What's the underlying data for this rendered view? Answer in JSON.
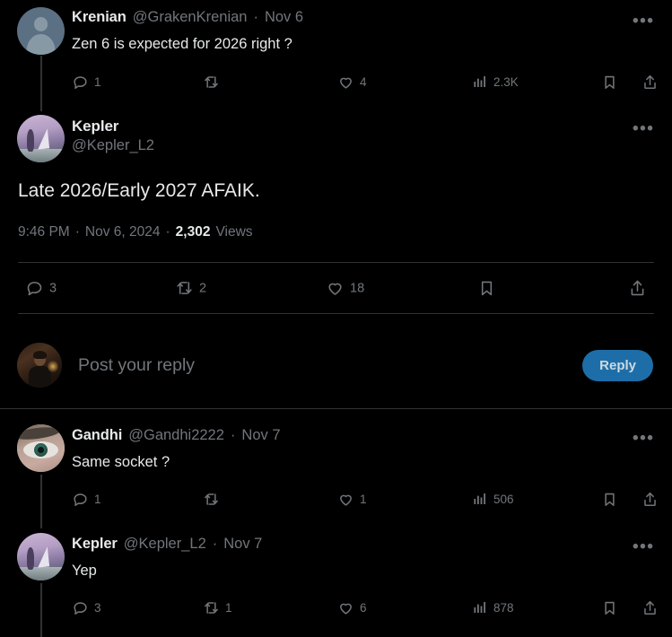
{
  "theme": {
    "background": "#000000",
    "text_primary": "#e7e9ea",
    "text_secondary": "#71767b",
    "border": "#2f3336",
    "accent_blue": "#1d6ea8",
    "reply_button_text": "#cfd9de"
  },
  "parent_tweet": {
    "author_name": "Krenian",
    "author_handle": "@GrakenKrenian",
    "separator": "·",
    "date": "Nov 6",
    "text": "Zen 6 is expected for 2026 right ?",
    "more_label": "•••",
    "avatar": "default-avatar-icon",
    "actions": {
      "reply_count": "1",
      "repost_count": "",
      "like_count": "4",
      "view_count": "2.3K"
    }
  },
  "main_tweet": {
    "author_name": "Kepler",
    "author_handle": "@Kepler_L2",
    "text": "Late 2026/Early 2027 AFAIK.",
    "more_label": "•••",
    "avatar": "kepler-avatar",
    "timestamp": {
      "time": "9:46 PM",
      "sep1": "·",
      "date": "Nov 6, 2024",
      "sep2": "·",
      "views_value": "2,302",
      "views_label": "Views"
    },
    "actions": {
      "reply_count": "3",
      "repost_count": "2",
      "like_count": "18",
      "bookmark_count": "",
      "share_count": ""
    }
  },
  "composer": {
    "placeholder": "Post your reply",
    "reply_label": "Reply",
    "avatar": "current-user-avatar"
  },
  "replies": [
    {
      "author_name": "Gandhi",
      "author_handle": "@Gandhi2222",
      "separator": "·",
      "date": "Nov 7",
      "text": "Same socket ?",
      "more_label": "•••",
      "avatar": "eye-avatar",
      "actions": {
        "reply_count": "1",
        "repost_count": "",
        "like_count": "1",
        "view_count": "506"
      }
    },
    {
      "author_name": "Kepler",
      "author_handle": "@Kepler_L2",
      "separator": "·",
      "date": "Nov 7",
      "text": "Yep",
      "more_label": "•••",
      "avatar": "kepler-avatar",
      "actions": {
        "reply_count": "3",
        "repost_count": "1",
        "like_count": "6",
        "view_count": "878"
      }
    }
  ],
  "icons": {
    "reply": "reply-icon",
    "repost": "repost-icon",
    "like": "like-icon",
    "views": "analytics-icon",
    "bookmark": "bookmark-icon",
    "share": "share-icon",
    "more": "more-options-icon"
  }
}
